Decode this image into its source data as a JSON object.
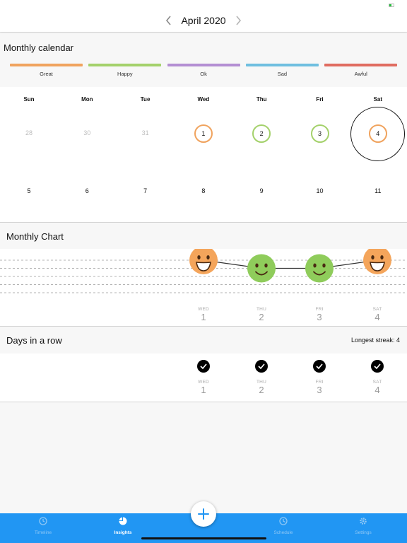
{
  "header": {
    "month_title": "April 2020"
  },
  "calendar": {
    "title": "Monthly calendar",
    "legend": [
      {
        "label": "Great",
        "color": "#f0a35e"
      },
      {
        "label": "Happy",
        "color": "#a4d16b"
      },
      {
        "label": "Ok",
        "color": "#b48fd3"
      },
      {
        "label": "Sad",
        "color": "#6fbfe0"
      },
      {
        "label": "Awful",
        "color": "#e06c60"
      }
    ],
    "weekdays": [
      "Sun",
      "Mon",
      "Tue",
      "Wed",
      "Thu",
      "Fri",
      "Sat"
    ],
    "week1": [
      {
        "day": "28",
        "mood": "none",
        "dim": true
      },
      {
        "day": "30",
        "mood": "none",
        "dim": true
      },
      {
        "day": "31",
        "mood": "none",
        "dim": true
      },
      {
        "day": "1",
        "mood": "Great"
      },
      {
        "day": "2",
        "mood": "Happy"
      },
      {
        "day": "3",
        "mood": "Happy"
      },
      {
        "day": "4",
        "mood": "Great",
        "today": true
      }
    ],
    "week2": [
      "5",
      "6",
      "7",
      "8",
      "9",
      "10",
      "11"
    ]
  },
  "chart": {
    "title": "Monthly Chart",
    "chart_data": {
      "type": "line",
      "x": [
        "WED 1",
        "THU 2",
        "FRI 3",
        "SAT 4"
      ],
      "series": [
        {
          "values": [
            "Great",
            "Happy",
            "Happy",
            "Great"
          ]
        }
      ],
      "y_levels": [
        "Great",
        "Happy",
        "Ok",
        "Sad",
        "Awful"
      ],
      "grid": true
    },
    "columns": [
      {
        "weekday": "WED",
        "day": "1"
      },
      {
        "weekday": "THU",
        "day": "2"
      },
      {
        "weekday": "FRI",
        "day": "3"
      },
      {
        "weekday": "SAT",
        "day": "4"
      }
    ]
  },
  "streak": {
    "title": "Days in a row",
    "longest_label": "Longest streak: 4",
    "columns": [
      {
        "weekday": "WED",
        "day": "1"
      },
      {
        "weekday": "THU",
        "day": "2"
      },
      {
        "weekday": "FRI",
        "day": "3"
      },
      {
        "weekday": "SAT",
        "day": "4"
      }
    ]
  },
  "tabbar": {
    "tabs": [
      {
        "label": "Timeline",
        "icon": "timeline-icon"
      },
      {
        "label": "Insights",
        "icon": "pie-chart-icon",
        "active": true
      },
      {
        "label": "Schedule",
        "icon": "clock-icon"
      },
      {
        "label": "Settings",
        "icon": "gear-icon"
      }
    ]
  },
  "colors": {
    "accent": "#2196f3",
    "great_face": "#f4a55b",
    "happy_face": "#8fcc5b"
  }
}
